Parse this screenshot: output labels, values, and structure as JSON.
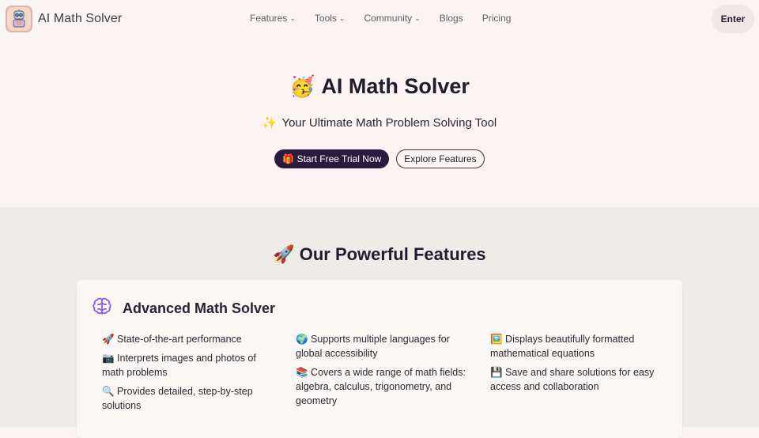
{
  "nav": {
    "brand": "AI Math Solver",
    "menu": [
      {
        "label": "Features",
        "dropdown": true
      },
      {
        "label": "Tools",
        "dropdown": true
      },
      {
        "label": "Community",
        "dropdown": true
      },
      {
        "label": "Blogs",
        "dropdown": false
      },
      {
        "label": "Pricing",
        "dropdown": false
      }
    ],
    "enter_label": "Enter"
  },
  "hero": {
    "title_emoji": "🥳",
    "title": "AI Math Solver",
    "subtitle_emoji": "✨",
    "subtitle": "Your Ultimate Math Problem Solving Tool",
    "primary_cta": "🎁 Start Free Trial Now",
    "secondary_cta": "Explore Features"
  },
  "features": {
    "section_emoji": "🚀",
    "section_title": "Our Powerful Features",
    "card": {
      "icon": "brain-icon",
      "title": "Advanced Math Solver",
      "columns": [
        [
          "🚀 State-of-the-art performance",
          "📷 Interprets images and photos of math problems",
          "🔍 Provides detailed, step-by-step solutions"
        ],
        [
          "🌍 Supports multiple languages for global accessibility",
          "📚 Covers a wide range of math fields: algebra, calculus, trigonometry, and geometry"
        ],
        [
          "🖼️ Displays beautifully formatted mathematical equations",
          "💾 Save and share solutions for easy access and collaboration"
        ]
      ]
    }
  },
  "colors": {
    "background": "#faf5f2",
    "features_bg": "#efebe8",
    "primary_button": "#2a1c3e",
    "brain_icon": "#8b5cf6"
  }
}
